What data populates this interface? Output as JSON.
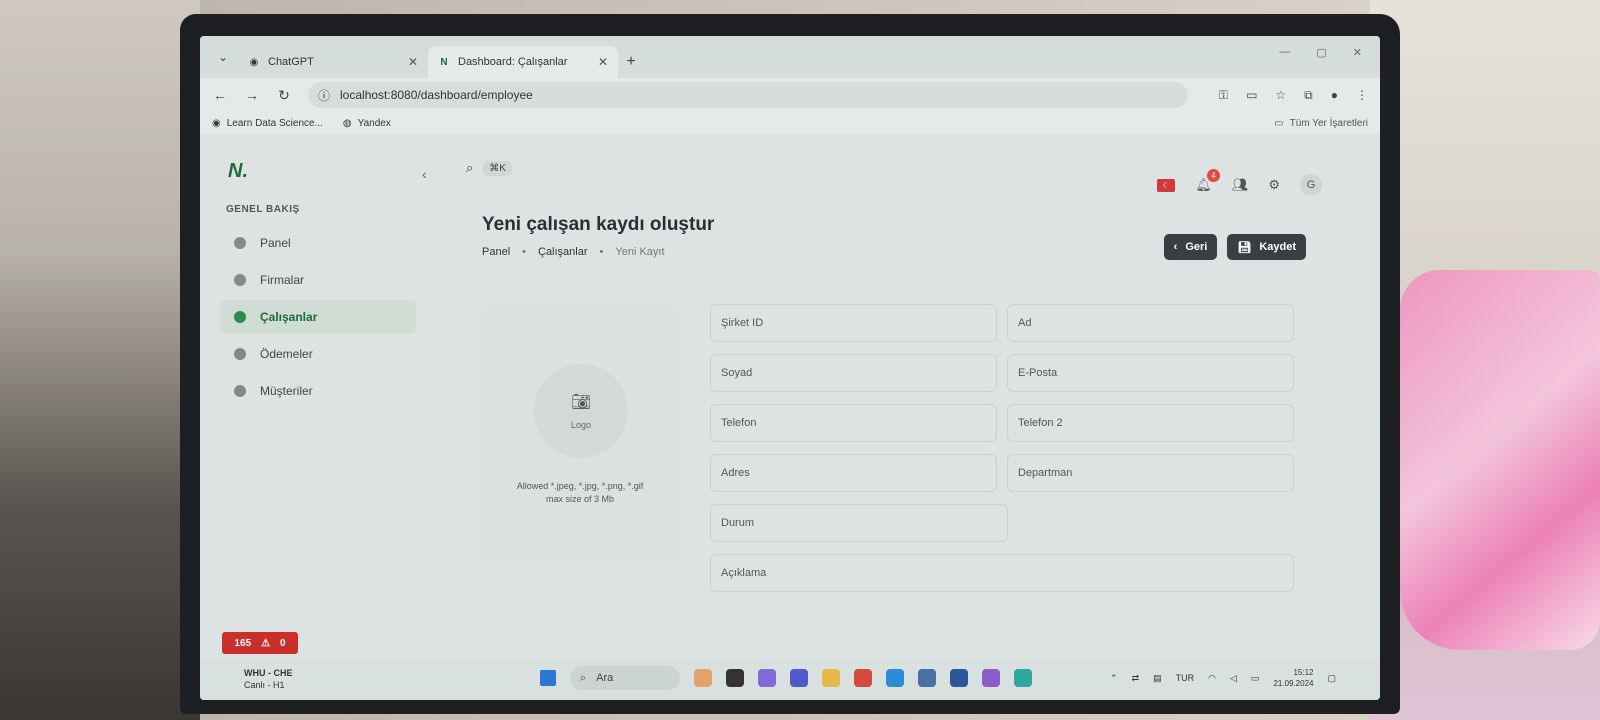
{
  "browser": {
    "tabs": [
      {
        "label": "ChatGPT",
        "active": false
      },
      {
        "label": "Dashboard: Çalışanlar",
        "active": true
      }
    ],
    "url": "localhost:8080/dashboard/employee",
    "bookmarks": [
      "Learn Data Science...",
      "Yandex"
    ],
    "all_bookmarks_label": "Tüm Yer İşaretleri"
  },
  "app": {
    "section_label": "GENEL BAKIŞ",
    "menu": [
      {
        "label": "Panel",
        "active": false
      },
      {
        "label": "Firmalar",
        "active": false
      },
      {
        "label": "Çalışanlar",
        "active": true
      },
      {
        "label": "Ödemeler",
        "active": false
      },
      {
        "label": "Müşteriler",
        "active": false
      }
    ],
    "search_shortcut": "⌘K",
    "notification_count": "4",
    "avatar_initial": "G",
    "page_title": "Yeni çalışan kaydı oluştur",
    "breadcrumbs": [
      "Panel",
      "Çalışanlar",
      "Yeni Kayıt"
    ],
    "back_label": "Geri",
    "save_label": "Kaydet",
    "upload": {
      "label": "Logo",
      "hint_line1": "Allowed *.jpeg, *.jpg, *.png, *.gif",
      "hint_line2": "max size of 3 Mb"
    },
    "fields": {
      "company_id": "Şirket ID",
      "first_name": "Ad",
      "last_name": "Soyad",
      "email": "E-Posta",
      "phone": "Telefon",
      "phone2": "Telefon 2",
      "address": "Adres",
      "department": "Departman",
      "status": "Durum",
      "description": "Açıklama"
    },
    "error_count": "165",
    "warning_count": "0"
  },
  "taskbar": {
    "sport_title": "WHU - CHE",
    "sport_sub": "Canlı - H1",
    "search_label": "Ara",
    "language": "TUR",
    "time": "15:12",
    "date": "21.09.2024"
  }
}
